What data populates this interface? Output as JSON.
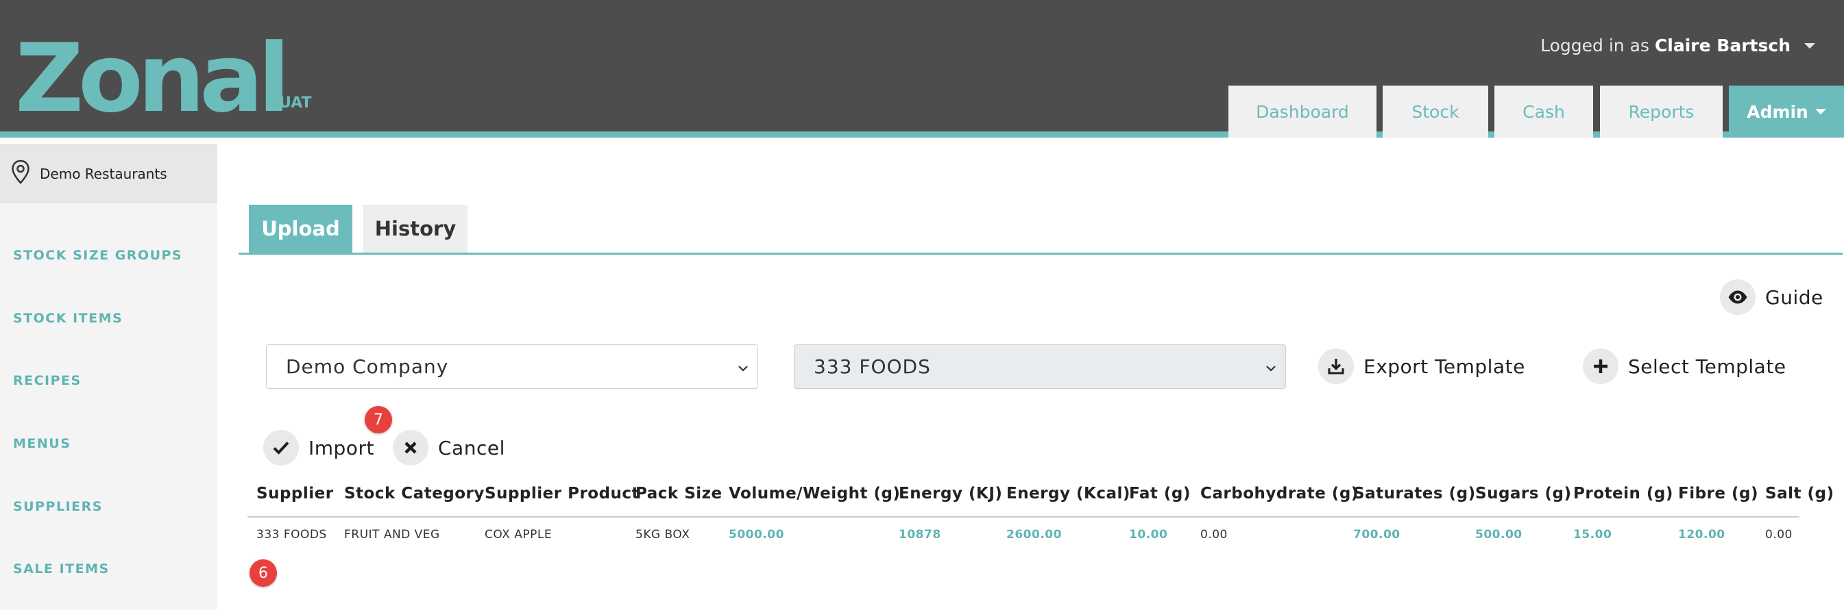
{
  "brand": {
    "logo_text": "Zonal",
    "env_label": "UAT",
    "accent": "#6bbcbb",
    "header_bg": "#4d4d4d"
  },
  "user": {
    "logged_in_prefix": "Logged in as",
    "name": "Claire Bartsch"
  },
  "nav": {
    "tabs": [
      {
        "label": "Dashboard"
      },
      {
        "label": "Stock"
      },
      {
        "label": "Cash"
      },
      {
        "label": "Reports"
      },
      {
        "label": "Admin",
        "active": true
      }
    ]
  },
  "sidebar": {
    "site": "Demo Restaurants",
    "items": [
      {
        "label": "STOCK SIZE GROUPS"
      },
      {
        "label": "STOCK ITEMS"
      },
      {
        "label": "RECIPES"
      },
      {
        "label": "MENUS"
      },
      {
        "label": "SUPPLIERS"
      },
      {
        "label": "SALE ITEMS"
      }
    ]
  },
  "tabs": [
    {
      "label": "Upload",
      "active": true
    },
    {
      "label": "History",
      "active": false
    }
  ],
  "guide": {
    "label": "Guide",
    "icon": "eye-icon"
  },
  "filters": {
    "company": {
      "value": "Demo Company"
    },
    "supplier": {
      "value": "333 FOODS"
    }
  },
  "actions": {
    "export_template": "Export Template",
    "select_template": "Select Template",
    "import": "Import",
    "cancel": "Cancel"
  },
  "annotations": {
    "badge_import": "7",
    "badge_table": "6",
    "badge_color": "#e8413c"
  },
  "table": {
    "columns": [
      "Supplier",
      "Stock Category",
      "Supplier Product",
      "Pack Size",
      "Volume/Weight (g)",
      "Energy (KJ)",
      "Energy (Kcal)",
      "Fat (g)",
      "Carbohydrate (g)",
      "Saturates (g)",
      "Sugars (g)",
      "Protein (g)",
      "Fibre (g)",
      "Salt (g)"
    ],
    "rows": [
      [
        "333 FOODS",
        "FRUIT AND VEG",
        "COX APPLE",
        "5KG BOX",
        "5000.00",
        "10878",
        "2600.00",
        "10.00",
        "0.00",
        "700.00",
        "500.00",
        "15.00",
        "120.00",
        "0.00"
      ]
    ]
  }
}
